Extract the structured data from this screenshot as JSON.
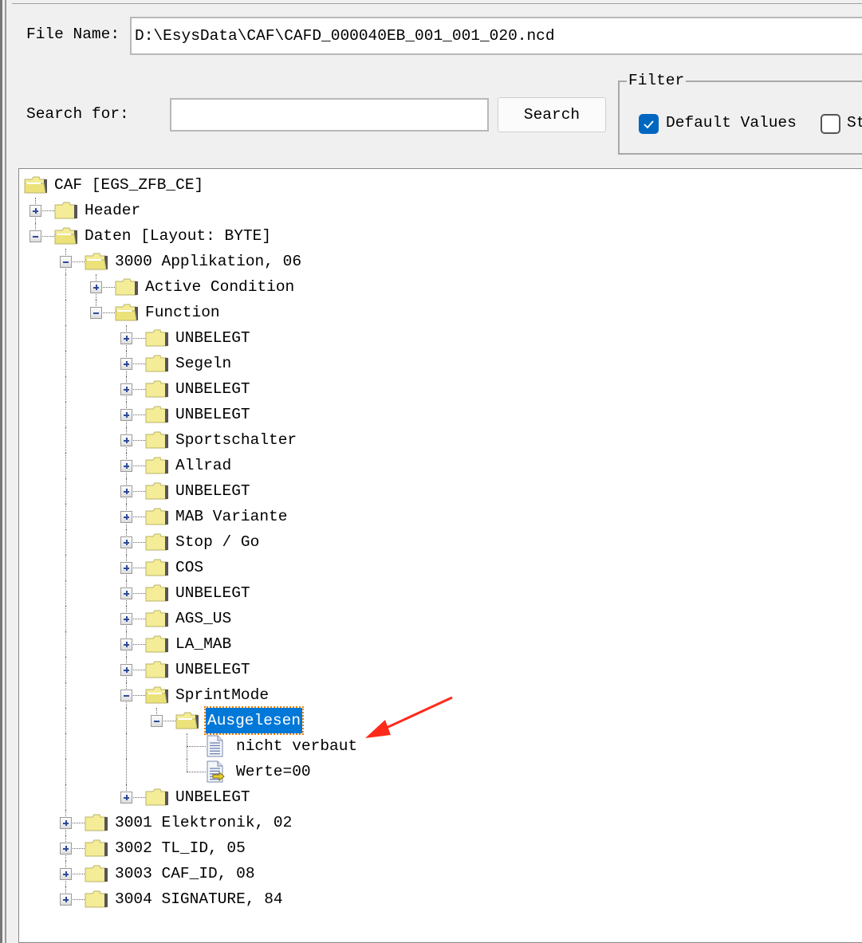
{
  "form": {
    "file_name_label": "File Name:",
    "file_name_value": "D:\\EsysData\\CAF\\CAFD_000040EB_001_001_020.ncd",
    "search_label": "Search for:",
    "search_value": "",
    "search_button": "Search"
  },
  "filter": {
    "title": "Filter",
    "options": [
      {
        "label": "Default Values",
        "checked": true
      },
      {
        "label": "St",
        "checked": false
      }
    ]
  },
  "colors": {
    "accent": "#0067c0",
    "selection": "#0078d7",
    "arrow": "#ff2a1a",
    "folder": "#f4ec96"
  },
  "tree": {
    "label": "CAF [EGS_ZFB_CE]",
    "icon": "folder-open",
    "expanded": true,
    "children": [
      {
        "label": "Header",
        "icon": "folder",
        "expanded": false
      },
      {
        "label": "Daten [Layout: BYTE]",
        "icon": "folder-open",
        "expanded": true,
        "children": [
          {
            "label": "3000 Applikation, 06",
            "icon": "folder-open",
            "expanded": true,
            "children": [
              {
                "label": "Active Condition",
                "icon": "folder",
                "expanded": false
              },
              {
                "label": "Function",
                "icon": "folder-open",
                "expanded": true,
                "children": [
                  {
                    "label": "UNBELEGT",
                    "icon": "folder",
                    "expanded": false
                  },
                  {
                    "label": "Segeln",
                    "icon": "folder",
                    "expanded": false
                  },
                  {
                    "label": "UNBELEGT",
                    "icon": "folder",
                    "expanded": false
                  },
                  {
                    "label": "UNBELEGT",
                    "icon": "folder",
                    "expanded": false
                  },
                  {
                    "label": "Sportschalter",
                    "icon": "folder",
                    "expanded": false
                  },
                  {
                    "label": "Allrad",
                    "icon": "folder",
                    "expanded": false
                  },
                  {
                    "label": "UNBELEGT",
                    "icon": "folder",
                    "expanded": false
                  },
                  {
                    "label": "MAB Variante",
                    "icon": "folder",
                    "expanded": false
                  },
                  {
                    "label": "Stop / Go",
                    "icon": "folder",
                    "expanded": false
                  },
                  {
                    "label": "COS",
                    "icon": "folder",
                    "expanded": false
                  },
                  {
                    "label": "UNBELEGT",
                    "icon": "folder",
                    "expanded": false
                  },
                  {
                    "label": "AGS_US",
                    "icon": "folder",
                    "expanded": false
                  },
                  {
                    "label": "LA_MAB",
                    "icon": "folder",
                    "expanded": false
                  },
                  {
                    "label": "UNBELEGT",
                    "icon": "folder",
                    "expanded": false
                  },
                  {
                    "label": "SprintMode",
                    "icon": "folder-open",
                    "expanded": true,
                    "children": [
                      {
                        "label": "Ausgelesen",
                        "icon": "folder-open",
                        "expanded": true,
                        "selected": true,
                        "children": [
                          {
                            "label": "nicht verbaut",
                            "icon": "document"
                          },
                          {
                            "label": "Werte=00",
                            "icon": "document-arrow"
                          }
                        ]
                      }
                    ]
                  },
                  {
                    "label": "UNBELEGT",
                    "icon": "folder",
                    "expanded": false
                  }
                ]
              }
            ]
          },
          {
            "label": "3001 Elektronik, 02",
            "icon": "folder",
            "expanded": false
          },
          {
            "label": "3002 TL_ID, 05",
            "icon": "folder",
            "expanded": false
          },
          {
            "label": "3003 CAF_ID, 08",
            "icon": "folder",
            "expanded": false
          },
          {
            "label": "3004 SIGNATURE, 84",
            "icon": "folder",
            "expanded": false
          }
        ]
      }
    ]
  }
}
